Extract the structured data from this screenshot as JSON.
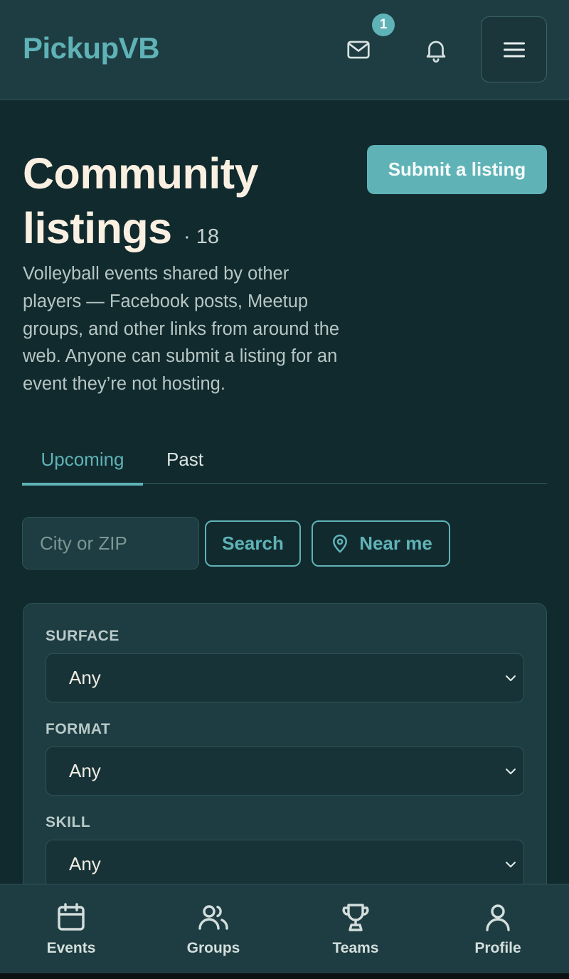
{
  "header": {
    "brand": "PickupVB",
    "mail_badge_count": "1",
    "icons": [
      "mail-icon",
      "bell-icon",
      "menu-icon"
    ]
  },
  "page": {
    "title": "Community listings",
    "count": "· 18",
    "submit_label": "Submit a listing",
    "description": "Volleyball events shared by other players — Facebook posts, Meetup groups, and other links from around the web. Anyone can submit a listing for an event they’re not hosting."
  },
  "tabs": [
    {
      "label": "Upcoming",
      "active": true
    },
    {
      "label": "Past",
      "active": false
    }
  ],
  "search": {
    "placeholder": "City or ZIP",
    "value": "",
    "search_label": "Search",
    "near_label": "Near me"
  },
  "filters": [
    {
      "label": "SURFACE",
      "value": "Any"
    },
    {
      "label": "FORMAT",
      "value": "Any"
    },
    {
      "label": "SKILL",
      "value": "Any"
    }
  ],
  "bottom_nav": [
    {
      "label": "Events",
      "icon": "calendar-icon"
    },
    {
      "label": "Groups",
      "icon": "users-icon"
    },
    {
      "label": "Teams",
      "icon": "trophy-icon"
    },
    {
      "label": "Profile",
      "icon": "user-icon"
    }
  ],
  "colors": {
    "accent": "#5fb3b7",
    "background": "#112a2e",
    "surface": "#1e3d42",
    "title": "#faf0e2"
  }
}
